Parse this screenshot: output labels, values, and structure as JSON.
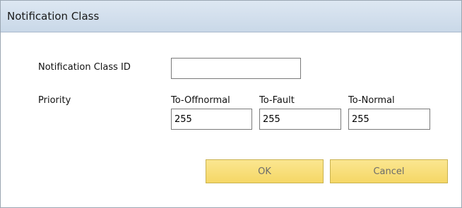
{
  "dialog": {
    "title": "Notification Class"
  },
  "form": {
    "id_label": "Notification Class ID",
    "id_value": "",
    "priority_label": "Priority",
    "columns": [
      {
        "label": "To-Offnormal",
        "value": "255"
      },
      {
        "label": "To-Fault",
        "value": "255"
      },
      {
        "label": "To-Normal",
        "value": "255"
      }
    ]
  },
  "buttons": {
    "ok_label": "OK",
    "cancel_label": "Cancel"
  }
}
